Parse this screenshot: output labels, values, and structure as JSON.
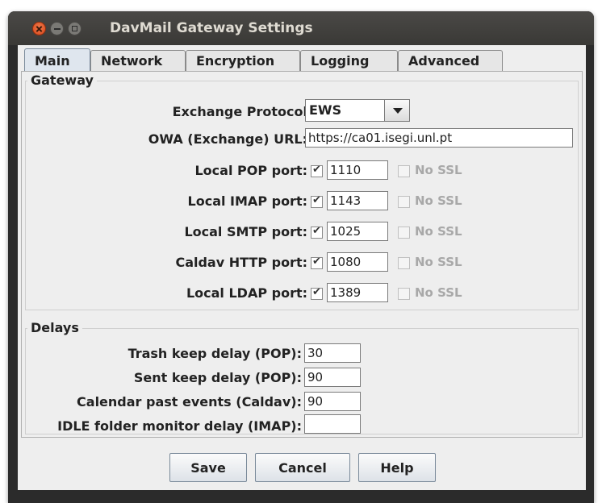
{
  "window": {
    "title": "DavMail Gateway Settings"
  },
  "tabs": [
    "Main",
    "Network",
    "Encryption",
    "Logging",
    "Advanced"
  ],
  "gateway": {
    "legend": "Gateway",
    "protocol_label": "Exchange Protocol",
    "protocol_value": "EWS",
    "owa_label": "OWA (Exchange) URL:",
    "owa_value": "https://ca01.isegi.unl.pt",
    "nossl_label": "No SSL",
    "ports": [
      {
        "label": "Local POP port:",
        "value": "1110",
        "enabled": true,
        "nossl": false
      },
      {
        "label": "Local IMAP port:",
        "value": "1143",
        "enabled": true,
        "nossl": false
      },
      {
        "label": "Local SMTP port:",
        "value": "1025",
        "enabled": true,
        "nossl": false
      },
      {
        "label": "Caldav HTTP port:",
        "value": "1080",
        "enabled": true,
        "nossl": false
      },
      {
        "label": "Local LDAP port:",
        "value": "1389",
        "enabled": true,
        "nossl": false
      }
    ]
  },
  "delays": {
    "legend": "Delays",
    "items": [
      {
        "label": "Trash keep delay (POP):",
        "value": "30"
      },
      {
        "label": "Sent keep delay (POP):",
        "value": "90"
      },
      {
        "label": "Calendar past events (Caldav):",
        "value": "90"
      },
      {
        "label": "IDLE folder monitor delay (IMAP):",
        "value": ""
      }
    ]
  },
  "buttons": {
    "save": "Save",
    "cancel": "Cancel",
    "help": "Help"
  }
}
